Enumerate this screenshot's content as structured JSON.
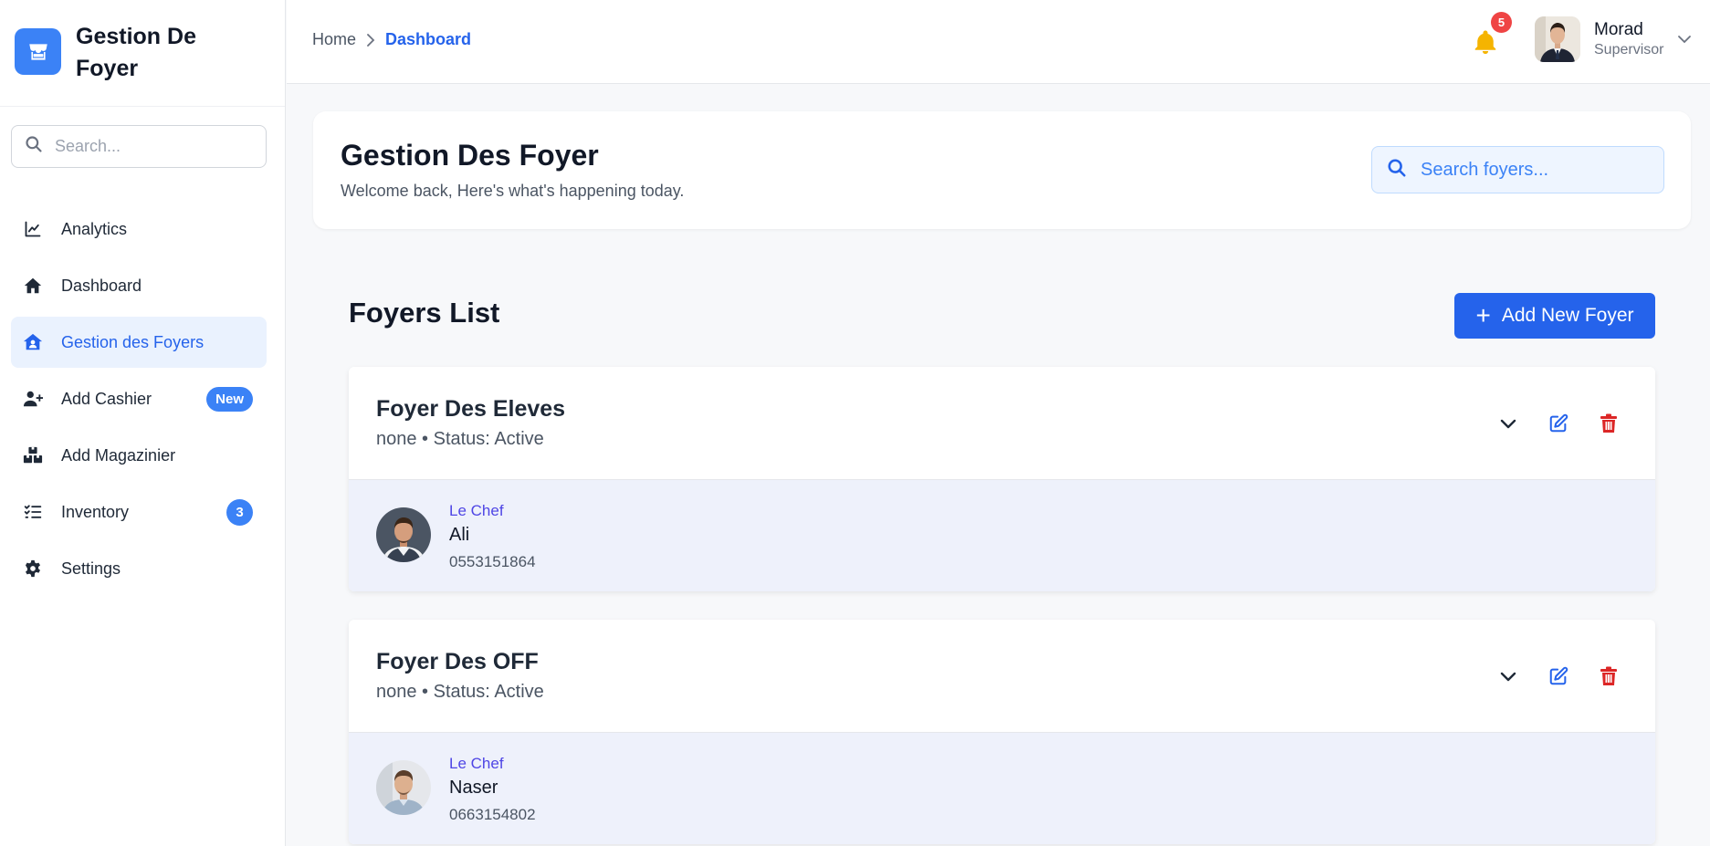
{
  "brand": {
    "title": "Gestion De Foyer",
    "icon": "store-icon",
    "accent": "#3b82f6"
  },
  "sidebar": {
    "search_placeholder": "Search...",
    "items": [
      {
        "label": "Analytics",
        "icon": "chart-line-icon",
        "active": false
      },
      {
        "label": "Dashboard",
        "icon": "home-icon",
        "active": false
      },
      {
        "label": "Gestion des Foyers",
        "icon": "house-user-icon",
        "active": true
      },
      {
        "label": "Add Cashier",
        "icon": "user-plus-icon",
        "active": false,
        "badge": "New"
      },
      {
        "label": "Add Magazinier",
        "icon": "boxes-icon",
        "active": false
      },
      {
        "label": "Inventory",
        "icon": "list-check-icon",
        "active": false,
        "badge": "3"
      },
      {
        "label": "Settings",
        "icon": "gear-icon",
        "active": false
      }
    ]
  },
  "topbar": {
    "breadcrumb": {
      "home": "Home",
      "current": "Dashboard"
    },
    "notifications_count": "5",
    "user": {
      "name": "Morad",
      "role": "Supervisor"
    }
  },
  "header": {
    "title": "Gestion Des Foyer",
    "subtitle": "Welcome back, Here's what's happening today.",
    "search_placeholder": "Search foyers..."
  },
  "foyers": {
    "title": "Foyers List",
    "add_label": "Add New Foyer",
    "items": [
      {
        "name": "Foyer Des Eleves",
        "meta": "none • Status: Active",
        "chef_role": "Le Chef",
        "chef_name": "Ali",
        "chef_phone": "0553151864"
      },
      {
        "name": "Foyer Des OFF",
        "meta": "none • Status: Active",
        "chef_role": "Le Chef",
        "chef_name": "Naser",
        "chef_phone": "0663154802"
      }
    ]
  },
  "colors": {
    "primary": "#2563eb",
    "danger": "#dc2626",
    "badge_red": "#ef4444",
    "chef_body": "#eef1fb"
  }
}
